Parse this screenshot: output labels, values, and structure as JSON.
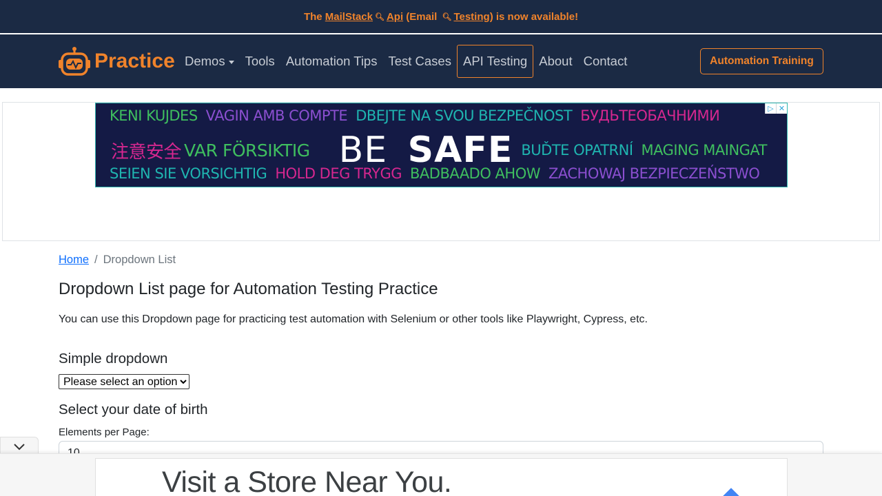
{
  "announcement": {
    "prefix": "The ",
    "link1": "MailStack",
    "link2": "Api",
    "middle": " (Email ",
    "link3": "Testing",
    "suffix": ") is now available!"
  },
  "navbar": {
    "brand": "Practice",
    "links": [
      "Demos",
      "Tools",
      "Automation Tips",
      "Test Cases",
      "API Testing",
      "About",
      "Contact"
    ],
    "cta": "Automation Training"
  },
  "ad_banner": {
    "row1": [
      "KENI KUJDES",
      "VAGIN AMB COMPTE",
      "DBEJTE NA SVOU BEZPEČNOST",
      "БУДЬТЕОБАЧНИМИ"
    ],
    "row2_left": [
      "注意安全",
      "VAR FÖRSIKTIG"
    ],
    "be": "BE",
    "safe": "SAFE",
    "row2_right": [
      "BUĎTE OPATRNÍ",
      "MAGING MAINGAT"
    ],
    "row3": [
      "SEIEN SIE VORSICHTIG",
      "HOLD DEG TRYGG",
      "BADBAADO AHOW",
      "ZACHOWAJ BEZPIECZEŃSTWO"
    ]
  },
  "breadcrumb": {
    "home": "Home",
    "separator": "/",
    "current": "Dropdown List"
  },
  "page": {
    "title": "Dropdown List page for Automation Testing Practice",
    "intro": "You can use this Dropdown page for practicing test automation with Selenium or other tools like Playwright, Cypress, etc.",
    "simple_heading": "Simple dropdown",
    "simple_selected": "Please select an option",
    "dob_heading": "Select your date of birth",
    "epp_label": "Elements per Page:",
    "epp_value": "10"
  },
  "bottom_ad": {
    "text": "Visit a Store Near You."
  },
  "colors": {
    "navy": "#1b2a44",
    "orange": "#f0832b",
    "link": "#0d6efd"
  }
}
